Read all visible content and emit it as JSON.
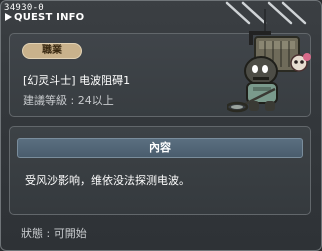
{
  "window": {
    "quest_id": "34930-0",
    "title": "QUEST INFO"
  },
  "quest": {
    "category": "職業",
    "name": "[幻灵斗士] 电波阻碍1",
    "level_requirement": "建議等級 : 24以上"
  },
  "content": {
    "header": "內容",
    "description": "受风沙影响，维依没法探测电波。"
  },
  "status": {
    "text": "狀態 : 可開始"
  },
  "npc": {
    "icon": "robot-npc-icon"
  },
  "colors": {
    "background": "#34383c",
    "category_pill": "#c9b28c",
    "content_header": "#52667a",
    "text_primary": "#ffffff",
    "text_secondary": "#c8cbce"
  }
}
